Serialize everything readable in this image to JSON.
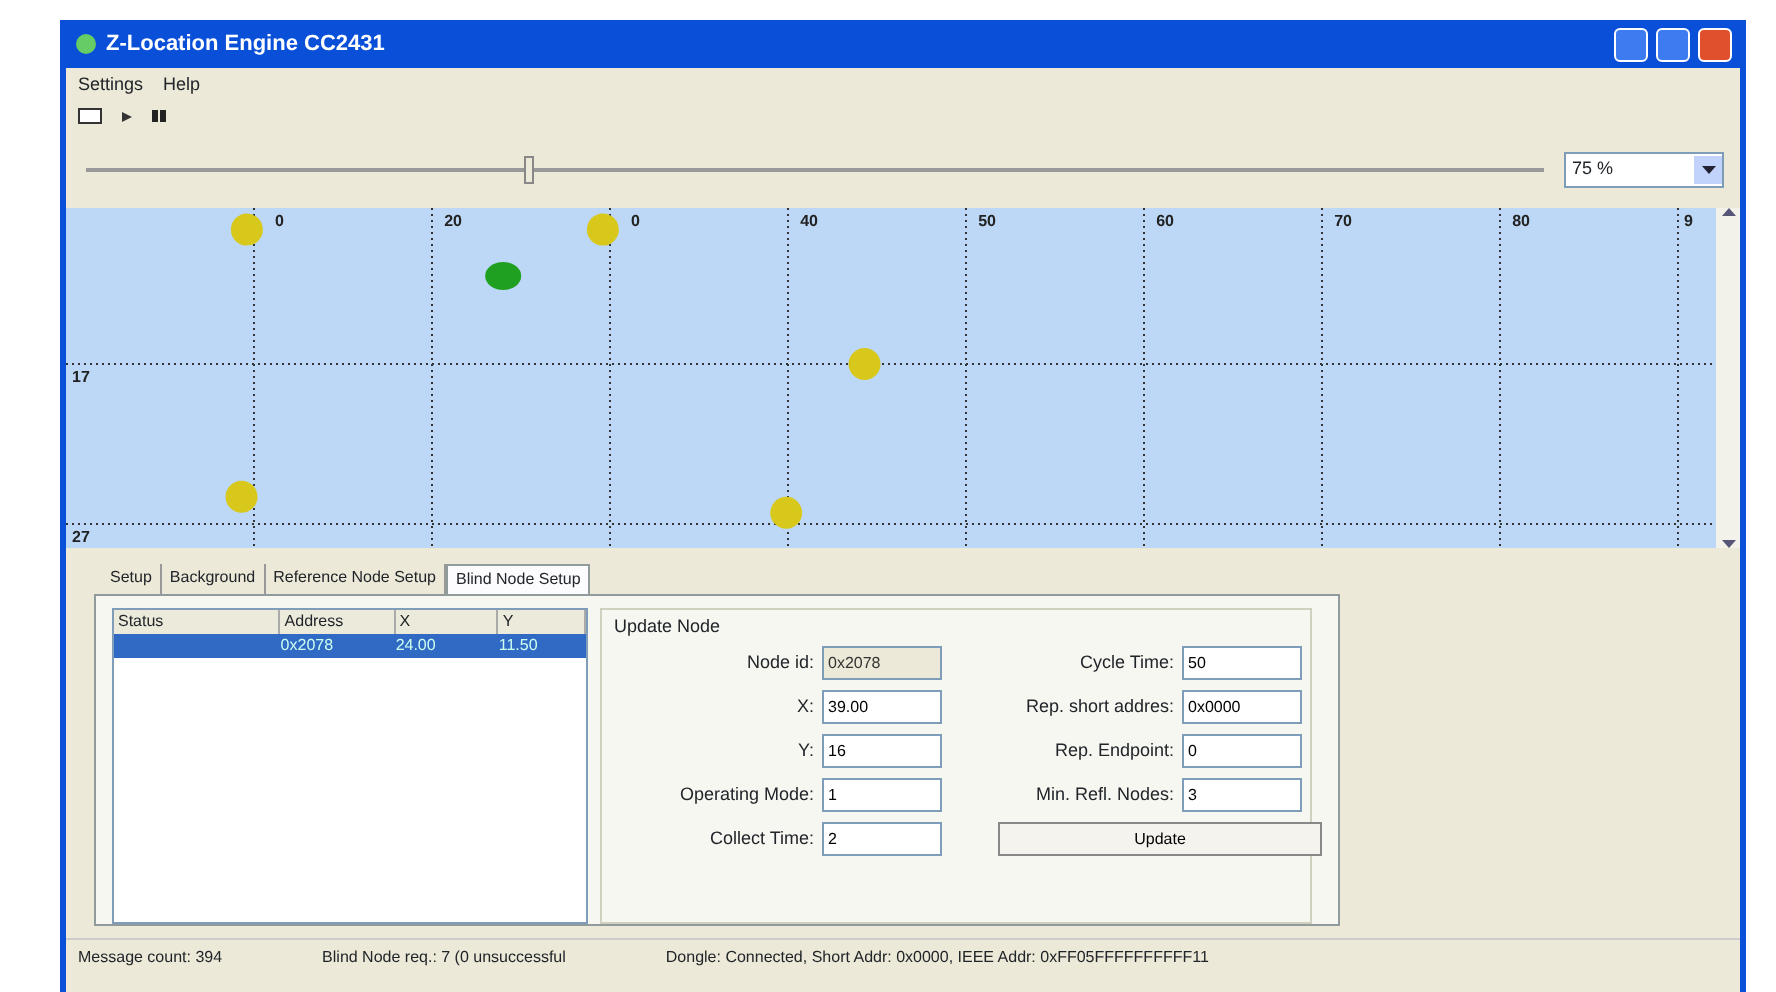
{
  "window": {
    "title": "Z-Location Engine CC2431"
  },
  "menu": [
    "Settings",
    "Help"
  ],
  "zoom": {
    "level": 0.3,
    "value": "75 %"
  },
  "map": {
    "x_labels": [
      "0",
      "20",
      "0",
      "40",
      "50",
      "60",
      "70",
      "80",
      "9"
    ],
    "y_labels": [
      "17",
      "27"
    ],
    "nodes": [
      {
        "kind": "reference",
        "color": "#d8c81c"
      },
      {
        "kind": "reference",
        "color": "#d8c81c"
      },
      {
        "kind": "blind",
        "color": "#20a020"
      },
      {
        "kind": "reference",
        "color": "#d8c81c"
      },
      {
        "kind": "reference",
        "color": "#d8c81c"
      },
      {
        "kind": "reference",
        "color": "#d8c81c"
      }
    ]
  },
  "tabs": [
    {
      "label": "Setup",
      "selected": false
    },
    {
      "label": "Background",
      "selected": false
    },
    {
      "label": "Reference Node Setup",
      "selected": false
    },
    {
      "label": "Blind Node Setup",
      "selected": true
    }
  ],
  "node_list": {
    "columns": [
      "Status",
      "Address",
      "X",
      "Y"
    ],
    "rows": [
      {
        "cells": [
          "",
          "0x2078",
          "24.00",
          "11.50"
        ],
        "selected": true
      }
    ]
  },
  "update_node": {
    "title": "Update Node",
    "left": [
      {
        "label": "Node id:",
        "value": "0x2078",
        "disabled": true
      },
      {
        "label": "X:",
        "value": "39.00",
        "disabled": false
      },
      {
        "label": "Y:",
        "value": "16",
        "disabled": false
      },
      {
        "label": "Operating Mode:",
        "value": "1",
        "disabled": false
      },
      {
        "label": "Collect Time:",
        "value": "2",
        "disabled": false
      }
    ],
    "right": [
      {
        "label": "Cycle Time:",
        "value": "50",
        "disabled": false
      },
      {
        "label": "Rep. short addres:",
        "value": "0x0000",
        "disabled": false
      },
      {
        "label": "Rep. Endpoint:",
        "value": "0",
        "disabled": false
      },
      {
        "label": "Min. Refl. Nodes:",
        "value": "3",
        "disabled": false
      }
    ],
    "button": "Update"
  },
  "status_bar": [
    "Message count: 394",
    "Blind Node req.: 7 (0 unsuccessful",
    "Dongle: Connected, Short Addr: 0x0000, IEEE Addr: 0xFF05FFFFFFFFFF11"
  ]
}
